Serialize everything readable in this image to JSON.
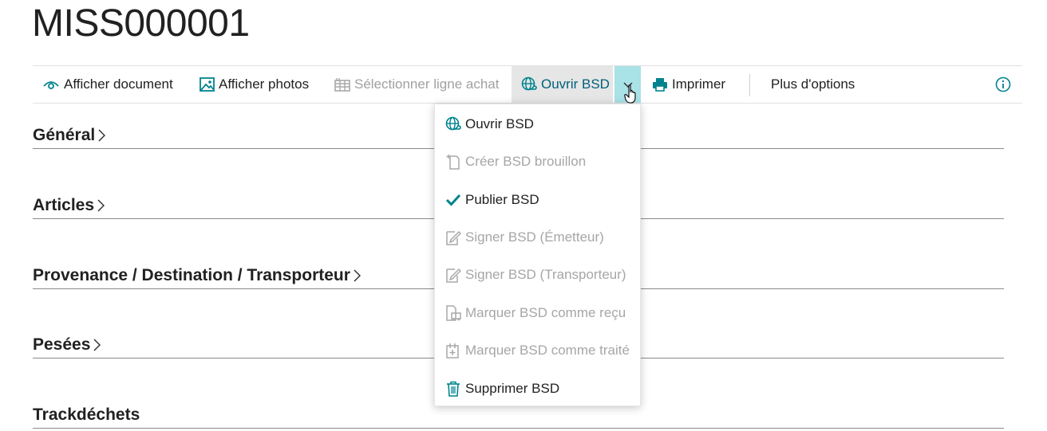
{
  "page": {
    "title": "MISS000001"
  },
  "toolbar": {
    "show_document": "Afficher document",
    "show_photos": "Afficher photos",
    "select_purchase_line": "Sélectionner ligne achat",
    "open_bsd": "Ouvrir BSD",
    "print": "Imprimer",
    "more_options": "Plus d'options"
  },
  "sections": {
    "general": "Général",
    "articles": "Articles",
    "route": "Provenance / Destination / Transporteur",
    "weighings": "Pesées",
    "trackdechets": "Trackdéchets"
  },
  "menu": {
    "items": [
      {
        "label": "Ouvrir BSD",
        "icon": "globe-link-icon",
        "enabled": true
      },
      {
        "label": "Créer BSD brouillon",
        "icon": "new-document-icon",
        "enabled": false
      },
      {
        "label": "Publier BSD",
        "icon": "checkmark-icon",
        "enabled": true
      },
      {
        "label": "Signer BSD (Émetteur)",
        "icon": "sign-document-icon",
        "enabled": false
      },
      {
        "label": "Signer BSD (Transporteur)",
        "icon": "sign-document-icon",
        "enabled": false
      },
      {
        "label": "Marquer BSD comme reçu",
        "icon": "received-icon",
        "enabled": false
      },
      {
        "label": "Marquer BSD comme traité",
        "icon": "processed-icon",
        "enabled": false
      },
      {
        "label": "Supprimer BSD",
        "icon": "trash-icon",
        "enabled": true
      }
    ]
  },
  "colors": {
    "accent": "#00838f",
    "chevron_bg": "#a9e2e7",
    "disabled": "#a0a0a0"
  }
}
